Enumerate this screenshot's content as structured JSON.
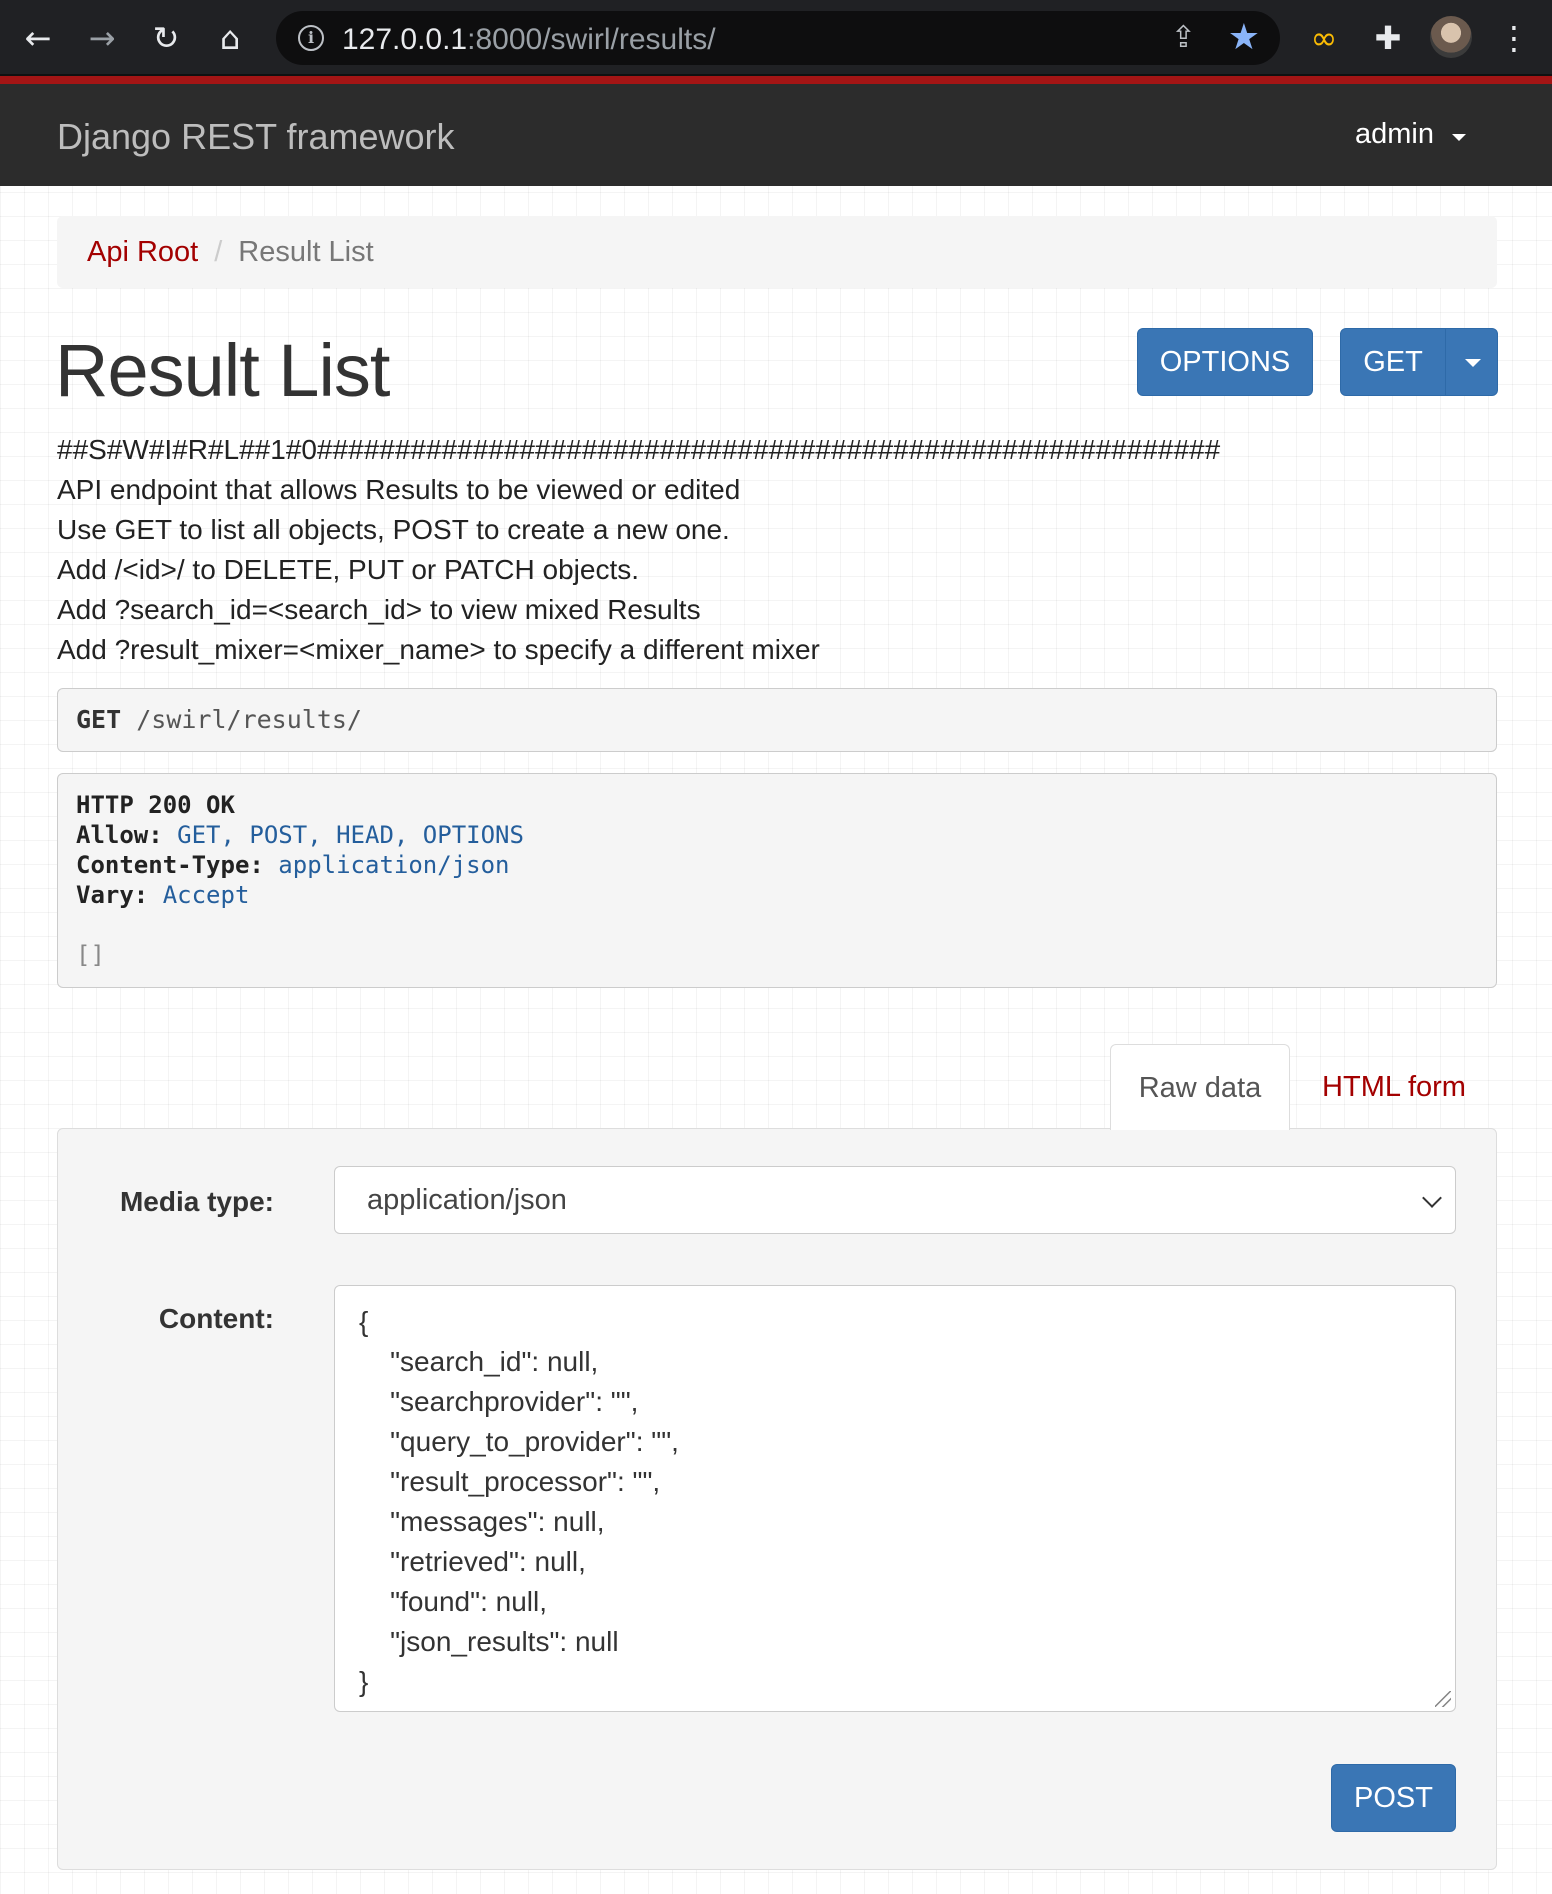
{
  "browser": {
    "url_host": "127.0.0.1",
    "url_rest": ":8000/swirl/results/",
    "icons": [
      "back-icon",
      "forward-icon",
      "reload-icon",
      "home-icon",
      "info-icon",
      "share-icon",
      "star-icon",
      "link-extension-icon",
      "puzzle-extensions-icon",
      "profile-avatar",
      "menu-kebab-icon"
    ]
  },
  "navbar": {
    "brand": "Django REST framework",
    "user": "admin"
  },
  "breadcrumb": {
    "root": "Api Root",
    "separator": "/",
    "current": "Result List"
  },
  "header": {
    "title": "Result List",
    "options_label": "OPTIONS",
    "get_label": "GET"
  },
  "description": [
    "##S#W#I#R#L##1#0##########################################################",
    "API endpoint that allows Results to be viewed or edited",
    "Use GET to list all objects, POST to create a new one.",
    "Add /<id>/ to DELETE, PUT or PATCH objects.",
    "Add ?search_id=<search_id> to view mixed Results",
    "Add ?result_mixer=<mixer_name> to specify a different mixer"
  ],
  "request": {
    "method": "GET",
    "path": "/swirl/results/"
  },
  "response": {
    "status": "HTTP 200 OK",
    "allow_key": "Allow:",
    "allow_val": "GET, POST, HEAD, OPTIONS",
    "ctype_key": "Content-Type:",
    "ctype_val": "application/json",
    "vary_key": "Vary:",
    "vary_val": "Accept",
    "body": "[]"
  },
  "tabs": {
    "raw": "Raw data",
    "html": "HTML form"
  },
  "form": {
    "media_label": "Media type:",
    "media_value": "application/json",
    "content_label": "Content:",
    "content_lines": [
      "{",
      "    \"search_id\": null,",
      "    \"searchprovider\": \"\",",
      "    \"query_to_provider\": \"\",",
      "    \"result_processor\": \"\",",
      "    \"messages\": null,",
      "    \"retrieved\": null,",
      "    \"found\": null,",
      "    \"json_results\": null",
      "}"
    ],
    "post_label": "POST"
  },
  "colors": {
    "accent_red": "#a30000",
    "primary_blue": "#3a76b5",
    "navbar": "#2c2c2c"
  }
}
